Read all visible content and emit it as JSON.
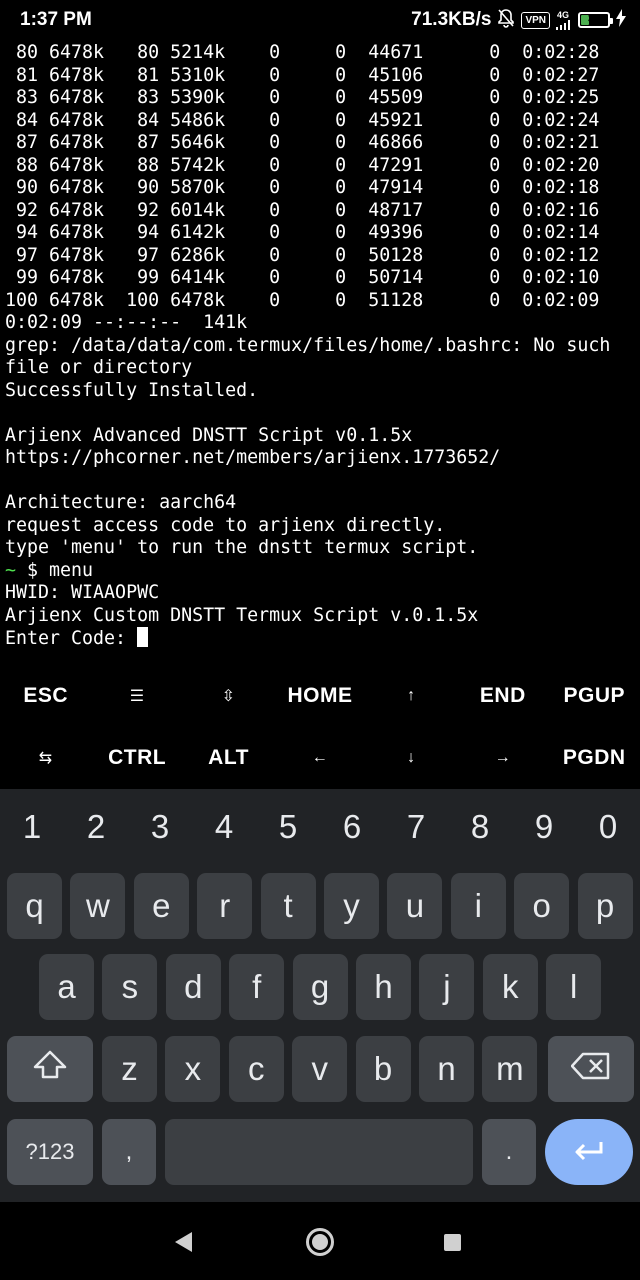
{
  "status_bar": {
    "time": "1:37 PM",
    "net_speed": "71.3KB/s",
    "vpn": "VPN",
    "network": "4G",
    "battery": "32",
    "battery_level_percent": 32
  },
  "terminal": {
    "lines": [
      " 80 6478k   80 5214k    0     0  44671      0  0:02:28",
      " 81 6478k   81 5310k    0     0  45106      0  0:02:27",
      " 83 6478k   83 5390k    0     0  45509      0  0:02:25",
      " 84 6478k   84 5486k    0     0  45921      0  0:02:24",
      " 87 6478k   87 5646k    0     0  46866      0  0:02:21",
      " 88 6478k   88 5742k    0     0  47291      0  0:02:20",
      " 90 6478k   90 5870k    0     0  47914      0  0:02:18",
      " 92 6478k   92 6014k    0     0  48717      0  0:02:16",
      " 94 6478k   94 6142k    0     0  49396      0  0:02:14",
      " 97 6478k   97 6286k    0     0  50128      0  0:02:12",
      " 99 6478k   99 6414k    0     0  50714      0  0:02:10",
      "100 6478k  100 6478k    0     0  51128      0  0:02:09",
      "0:02:09 --:--:--  141k",
      "grep: /data/data/com.termux/files/home/.bashrc: No such",
      "file or directory",
      "Successfully Installed.",
      "",
      "Arjienx Advanced DNSTT Script v0.1.5x",
      "https://phcorner.net/members/arjienx.1773652/",
      "",
      "Architecture: aarch64",
      "request access code to arjienx directly.",
      "type 'menu' to run the dnstt termux script."
    ],
    "prompt_tilde": "~",
    "prompt_command": " $ menu",
    "hwid": "HWID: WIAAOPWC",
    "script_title": "Arjienx Custom DNSTT Termux Script v.0.1.5x",
    "input_prompt": "Enter Code: "
  },
  "extra_keys": {
    "row1": [
      "ESC",
      "☰",
      "⇳",
      "HOME",
      "↑",
      "END",
      "PGUP"
    ],
    "row2": [
      "⇆",
      "CTRL",
      "ALT",
      "←",
      "↓",
      "→",
      "PGDN"
    ]
  },
  "keyboard": {
    "numbers": [
      "1",
      "2",
      "3",
      "4",
      "5",
      "6",
      "7",
      "8",
      "9",
      "0"
    ],
    "row1": [
      "q",
      "w",
      "e",
      "r",
      "t",
      "y",
      "u",
      "i",
      "o",
      "p"
    ],
    "row2": [
      "a",
      "s",
      "d",
      "f",
      "g",
      "h",
      "j",
      "k",
      "l"
    ],
    "row3": [
      "z",
      "x",
      "c",
      "v",
      "b",
      "n",
      "m"
    ],
    "symbols_key": "?123",
    "comma_key": ",",
    "period_key": ".",
    "shift_icon": "shift-icon",
    "backspace_icon": "backspace-icon",
    "enter_icon": "enter-icon",
    "accent_color": "#8ab4f8"
  },
  "nav_bar": {
    "back_icon": "back-icon",
    "home_icon": "home-icon",
    "recents_icon": "recents-icon"
  }
}
